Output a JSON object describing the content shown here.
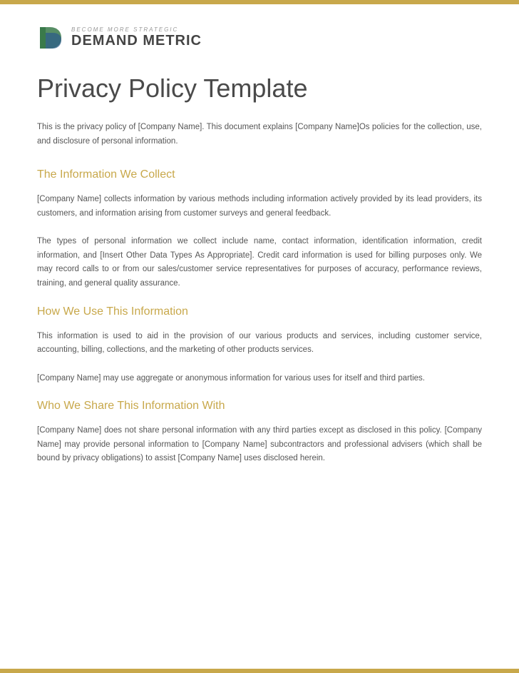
{
  "brand": {
    "tagline": "Become More Strategic",
    "name": "Demand Metric"
  },
  "document": {
    "title": "Privacy Policy Template",
    "intro": "This is the privacy policy of [Company Name]. This document explains [Company Name]Os policies for the collection, use, and disclosure of personal information."
  },
  "sections": [
    {
      "id": "section-collect",
      "heading": "The Information We Collect",
      "paragraphs": [
        "[Company Name] collects information by various methods including information actively provided by its lead providers, its customers, and information arising from customer surveys and general feedback.",
        "The types of personal information we collect include name, contact information, identification information, credit information, and [Insert Other Data Types As Appropriate]. Credit card information is used for billing purposes only. We may record calls to or from our sales/customer service representatives for purposes of accuracy, performance reviews, training, and general quality assurance."
      ]
    },
    {
      "id": "section-use",
      "heading": "How We Use This Information",
      "paragraphs": [
        "This information is used to aid in the provision of our various products and services, including customer service, accounting, billing, collections, and the marketing of other products services.",
        "[Company Name] may use aggregate or anonymous information for various uses for itself and third parties."
      ]
    },
    {
      "id": "section-share",
      "heading": "Who We Share This Information With",
      "paragraphs": [
        "[Company Name] does not share personal information with any third parties except as disclosed in this policy. [Company Name] may provide personal information to [Company Name] subcontractors and professional advisers (which shall be bound by privacy obligations) to assist [Company Name] uses disclosed herein."
      ]
    }
  ],
  "colors": {
    "accent": "#c8a84b",
    "heading_text": "#4a4a4a",
    "body_text": "#555555",
    "logo_text": "#444444"
  }
}
